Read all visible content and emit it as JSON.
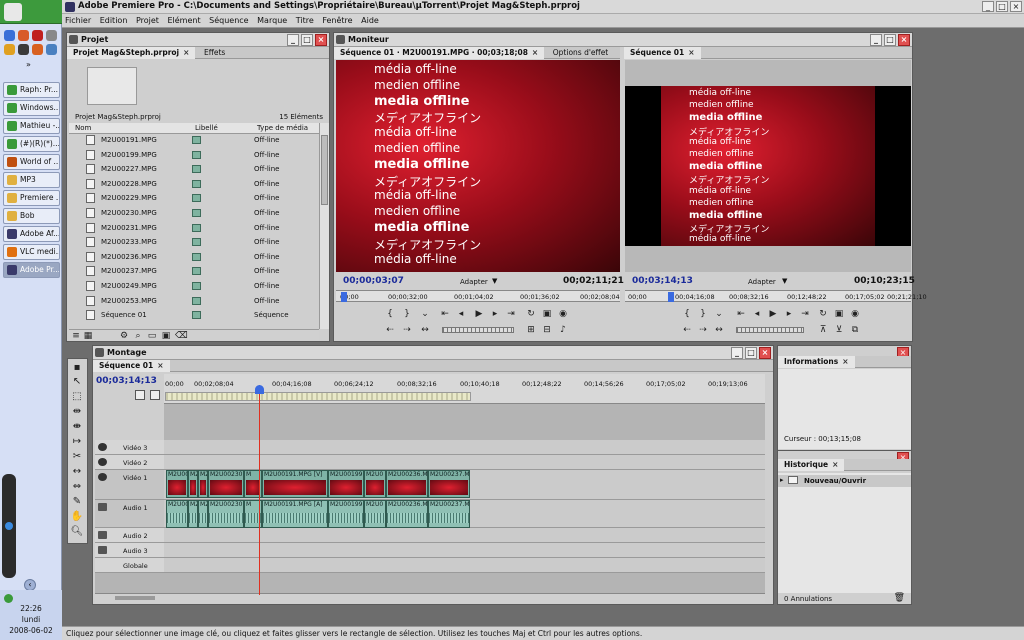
{
  "app": {
    "title": "Adobe Premiere Pro - C:\\Documents and Settings\\Propriétaire\\Bureau\\µTorrent\\Projet Mag&Steph.prproj"
  },
  "menu": [
    "Fichier",
    "Edition",
    "Projet",
    "Elément",
    "Séquence",
    "Marque",
    "Titre",
    "Fenêtre",
    "Aide"
  ],
  "taskbar": {
    "buttons": [
      "Raph: Pr...",
      "Windows...",
      "Mathieu -...",
      "(#)(R)(*)...",
      "World of ...",
      "MP3",
      "Premiere ...",
      "Bob",
      "Adobe Af...",
      "VLC medi...",
      "Adobe Pr..."
    ],
    "clock": {
      "time": "22:26",
      "day": "lundi",
      "date": "2008-06-02"
    }
  },
  "project": {
    "panel_title": "Projet",
    "tabs": [
      "Projet Mag&Steph.prproj",
      "Effets"
    ],
    "filename": "Projet Mag&Steph.prproj",
    "count": "15 Eléments",
    "columns": [
      "Nom",
      "Libellé",
      "Type de média"
    ],
    "rows": [
      {
        "name": "M2U00191.MPG",
        "type": "Off-line"
      },
      {
        "name": "M2U00199.MPG",
        "type": "Off-line"
      },
      {
        "name": "M2U00227.MPG",
        "type": "Off-line"
      },
      {
        "name": "M2U00228.MPG",
        "type": "Off-line"
      },
      {
        "name": "M2U00229.MPG",
        "type": "Off-line"
      },
      {
        "name": "M2U00230.MPG",
        "type": "Off-line"
      },
      {
        "name": "M2U00231.MPG",
        "type": "Off-line"
      },
      {
        "name": "M2U00233.MPG",
        "type": "Off-line"
      },
      {
        "name": "M2U00236.MPG",
        "type": "Off-line"
      },
      {
        "name": "M2U00237.MPG",
        "type": "Off-line"
      },
      {
        "name": "M2U00249.MPG",
        "type": "Off-line"
      },
      {
        "name": "M2U00253.MPG",
        "type": "Off-line"
      },
      {
        "name": "Séquence 01",
        "type": "Séquence"
      }
    ]
  },
  "monitor": {
    "panel_title": "Moniteur",
    "source_tab": "Séquence 01 · M2U00191.MPG · 00;03;18;08",
    "effects_tab": "Options d'effet",
    "source_tc": "00;00;03;07",
    "source_dur": "00;02;11;21",
    "fit": "Adapter",
    "source_ruler": [
      "00;00",
      "00;00;32;00",
      "00;01;04;02",
      "00;01;36;02",
      "00;02;08;04"
    ],
    "program_tab": "Séquence 01",
    "program_tc": "00;03;14;13",
    "program_dur": "00;10;23;15",
    "program_ruler": [
      "00;00",
      "00;04;16;08",
      "00;08;32;16",
      "00;12;48;22",
      "00;17;05;02",
      "00;21;21;10"
    ],
    "offline_lines": [
      "média off-line",
      "medien offline",
      "media offline",
      "メディアオフライン",
      "média off-line",
      "medien offline",
      "media offline",
      "メディアオフライン",
      "média off-line",
      "medien offline",
      "media offline",
      "メディアオフライン",
      "média off-line"
    ]
  },
  "timeline": {
    "panel_title": "Montage",
    "tab": "Séquence 01",
    "tc": "00;03;14;13",
    "ruler": [
      "00;00",
      "00;02;08;04",
      "00;04;16;08",
      "00;06;24;12",
      "00;08;32;16",
      "00;10;40;18",
      "00;12;48;22",
      "00;14;56;26",
      "00;17;05;02",
      "00;19;13;06"
    ],
    "tracks": {
      "video3": "Vidéo 3",
      "video2": "Vidéo 2",
      "video1": "Vidéo 1",
      "audio1": "Audio 1",
      "audio2": "Audio 2",
      "audio3": "Audio 3",
      "master": "Globale"
    },
    "video_clips": [
      "M2U00",
      "M2",
      "M2",
      "M2U00230",
      "M",
      "M2U00191.MPG [V]",
      "M2U00199",
      "M2U0",
      "M2U00236.MP",
      "M2U00237.M"
    ],
    "audio_clips": [
      "M2U00",
      "M2",
      "M2",
      "M2U00230",
      "M",
      "M2U00191.MPG [A]",
      "M2U00199",
      "M2U0",
      "M2U00236.MP",
      "M2U00237.M"
    ]
  },
  "info": {
    "tab": "Informations",
    "cursor": "Curseur : 00;13;15;08"
  },
  "history": {
    "tab": "Historique",
    "item": "Nouveau/Ouvrir",
    "undo": "0 Annulations"
  },
  "status": "Cliquez pour sélectionner une image clé, ou cliquez et faites glisser vers le rectangle de sélection. Utilisez les touches Maj et Ctrl pour les autres options."
}
